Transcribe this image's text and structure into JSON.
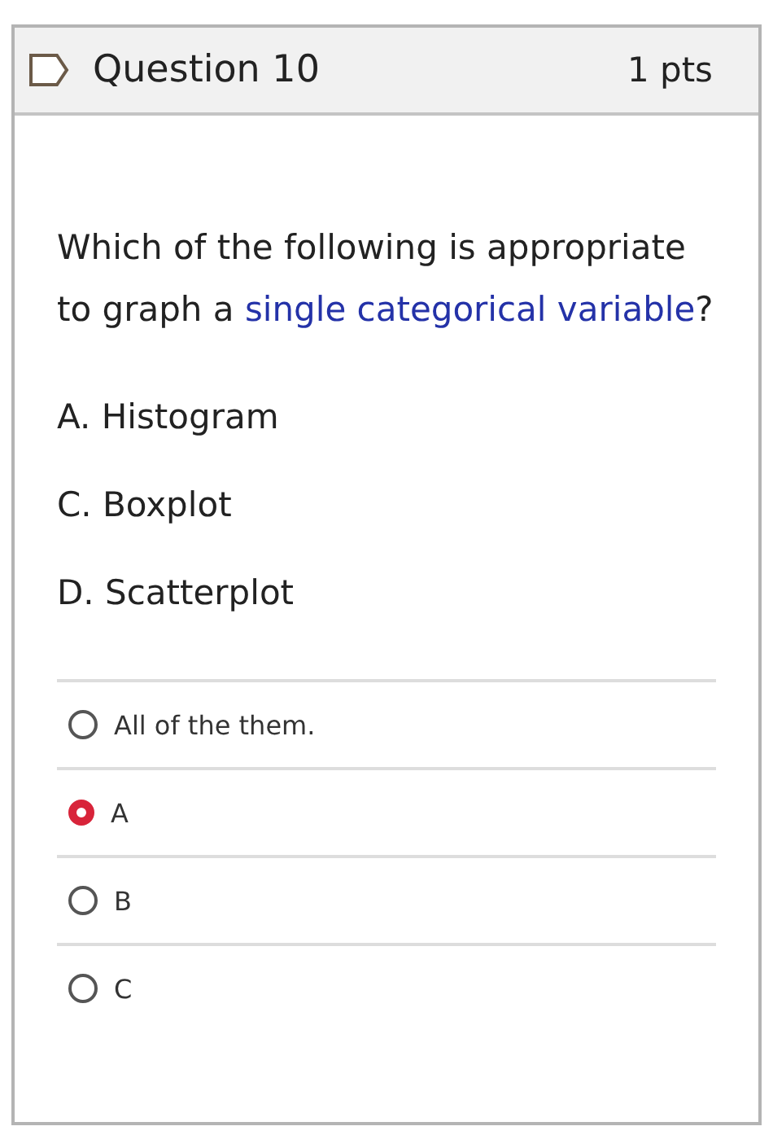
{
  "header": {
    "title": "Question 10",
    "points": "1 pts"
  },
  "question": [
    {
      "text": "Which of the following is appropriate to graph a ",
      "highlighted": false
    },
    {
      "text": "single categorical variable",
      "highlighted": true
    },
    {
      "text": "?",
      "highlighted": false
    }
  ],
  "statements": [
    "A. Histogram",
    "C. Boxplot",
    "D. Scatterplot"
  ],
  "answers": [
    {
      "label": "All of the them.",
      "selected": false
    },
    {
      "label": "A",
      "selected": true
    },
    {
      "label": "B",
      "selected": false
    },
    {
      "label": "C",
      "selected": false
    }
  ]
}
